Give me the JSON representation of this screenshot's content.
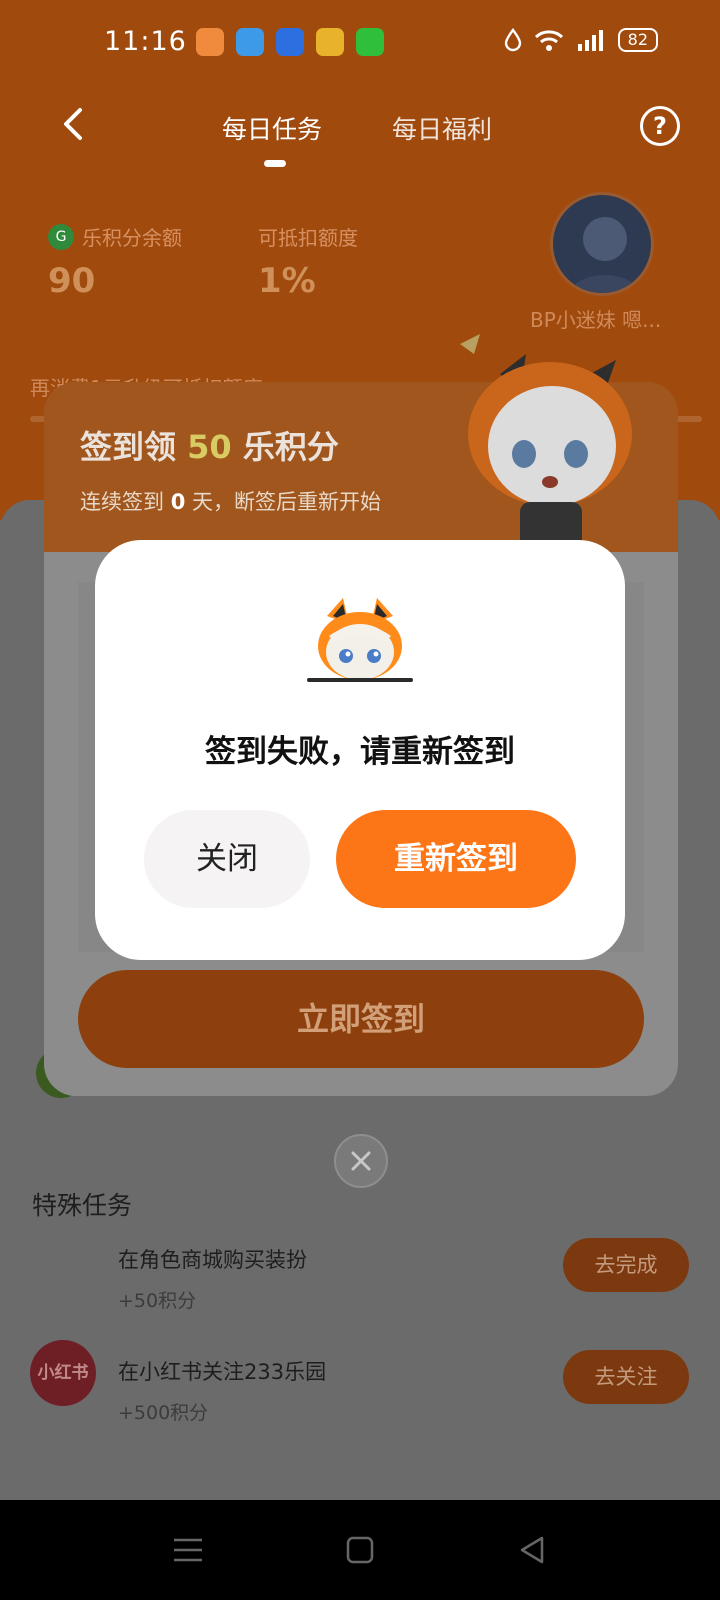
{
  "status_bar": {
    "time": "11:16",
    "battery": "82"
  },
  "header": {
    "tabs": [
      {
        "label": "每日任务"
      },
      {
        "label": "每日福利"
      }
    ]
  },
  "stats": {
    "balance_label": "乐积分余额",
    "balance_value": "90",
    "deduct_label": "可抵扣额度",
    "deduct_value": "1%",
    "coin_icon_text": "G"
  },
  "profile": {
    "username": "BP小迷妹 嗯..."
  },
  "upgrade_text": "再消费1元升级可抵扣额度",
  "checkin_card": {
    "title_prefix": "签到领 ",
    "title_number": "50",
    "title_suffix": " 乐积分",
    "subtitle_prefix": "连续签到 ",
    "subtitle_days": "0",
    "subtitle_suffix": " 天，断签后重新开始",
    "button_label": "立即签到"
  },
  "dialog": {
    "message": "签到失败，请重新签到",
    "close_label": "关闭",
    "retry_label": "重新签到"
  },
  "special_tasks": {
    "title": "特殊任务",
    "items": [
      {
        "name": "在角色商城购买装扮",
        "points": "+50积分",
        "button": "去完成"
      },
      {
        "name": "在小红书关注233乐园",
        "points": "+500积分",
        "button": "去关注",
        "logo_text": "小红书"
      }
    ]
  },
  "colors": {
    "accent": "#fc7618",
    "hero_dim": "#a04a0e"
  }
}
